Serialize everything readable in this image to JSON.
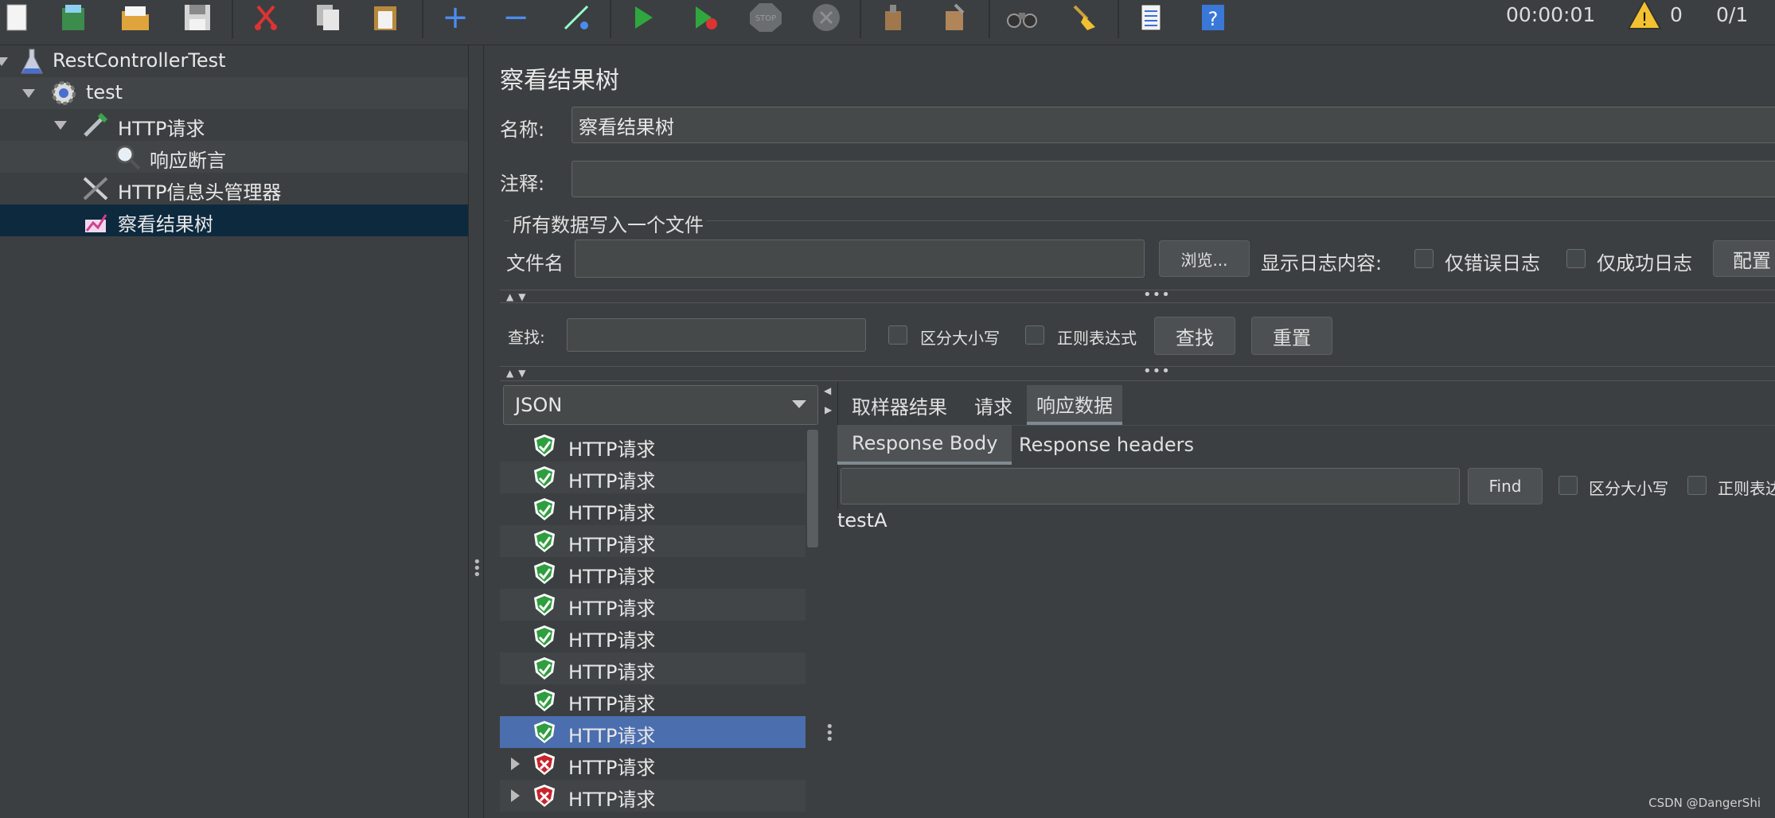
{
  "toolbar": {
    "timer": "00:00:01",
    "warning_count": "0",
    "thread_count": "0/1",
    "stop_label": "STOP"
  },
  "tree": {
    "items": [
      {
        "label": "RestControllerTest"
      },
      {
        "label": "test"
      },
      {
        "label": "HTTP请求"
      },
      {
        "label": "响应断言"
      },
      {
        "label": "HTTP信息头管理器"
      },
      {
        "label": "察看结果树"
      }
    ]
  },
  "panel": {
    "title": "察看结果树",
    "name_label": "名称:",
    "name_value": "察看结果树",
    "comment_label": "注释:",
    "comment_value": "",
    "file_section_title": "所有数据写入一个文件",
    "filename_label": "文件名",
    "filename_value": "",
    "browse_button": "浏览...",
    "log_label": "显示日志内容:",
    "errors_only": "仅错误日志",
    "success_only": "仅成功日志",
    "configure_button": "配置",
    "search_label": "查找:",
    "search_value": "",
    "case_sensitive": "区分大小写",
    "regex": "正则表达式",
    "find_button": "查找",
    "reset_button": "重置"
  },
  "renderer": {
    "selected": "JSON"
  },
  "results": [
    {
      "label": "HTTP请求",
      "status": "success"
    },
    {
      "label": "HTTP请求",
      "status": "success"
    },
    {
      "label": "HTTP请求",
      "status": "success"
    },
    {
      "label": "HTTP请求",
      "status": "success"
    },
    {
      "label": "HTTP请求",
      "status": "success"
    },
    {
      "label": "HTTP请求",
      "status": "success"
    },
    {
      "label": "HTTP请求",
      "status": "success"
    },
    {
      "label": "HTTP请求",
      "status": "success"
    },
    {
      "label": "HTTP请求",
      "status": "success"
    },
    {
      "label": "HTTP请求",
      "status": "success"
    },
    {
      "label": "HTTP请求",
      "status": "error"
    },
    {
      "label": "HTTP请求",
      "status": "error"
    }
  ],
  "tabs": {
    "sampler_result": "取样器结果",
    "request": "请求",
    "response_data": "响应数据"
  },
  "subtabs": {
    "response_body": "Response Body",
    "response_headers": "Response headers"
  },
  "response": {
    "find_button": "Find",
    "case_sensitive": "区分大小写",
    "regex": "正则表达",
    "body": "testA"
  },
  "watermark": "CSDN @DangerShi",
  "colors": {
    "background": "#3c3f41",
    "selection_tree": "#0d293e",
    "selection_list": "#4b6eaf",
    "success": "#2e9e3e",
    "error": "#c8242c"
  }
}
